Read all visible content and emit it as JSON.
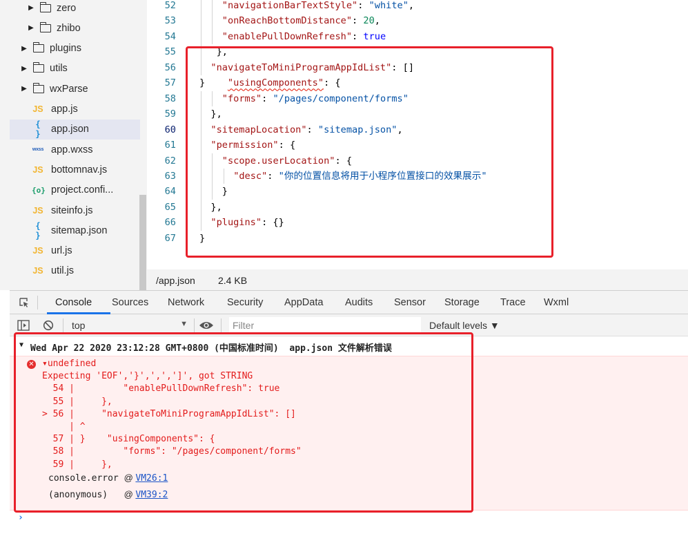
{
  "file_tree": {
    "items": [
      {
        "type": "folder",
        "label": "zero",
        "indent": 2
      },
      {
        "type": "folder",
        "label": "zhibo",
        "indent": 2
      },
      {
        "type": "folder",
        "label": "plugins",
        "indent": 1
      },
      {
        "type": "folder",
        "label": "utils",
        "indent": 1
      },
      {
        "type": "folder",
        "label": "wxParse",
        "indent": 1
      },
      {
        "type": "js",
        "label": "app.js",
        "icon": "JS"
      },
      {
        "type": "json",
        "label": "app.json",
        "icon": "{ }",
        "selected": true
      },
      {
        "type": "wxss",
        "label": "app.wxss",
        "icon": "wxss"
      },
      {
        "type": "js",
        "label": "bottomnav.js",
        "icon": "JS"
      },
      {
        "type": "config",
        "label": "project.confi...",
        "icon": "{o}"
      },
      {
        "type": "js",
        "label": "siteinfo.js",
        "icon": "JS"
      },
      {
        "type": "json",
        "label": "sitemap.json",
        "icon": "{ }"
      },
      {
        "type": "js",
        "label": "url.js",
        "icon": "JS"
      },
      {
        "type": "js",
        "label": "util.js",
        "icon": "JS"
      }
    ]
  },
  "editor": {
    "lines": [
      {
        "num": "52",
        "indent": 4,
        "tokens": [
          [
            "k",
            "\"navigationBarTextStyle\""
          ],
          [
            "p",
            ": "
          ],
          [
            "s",
            "\"white\""
          ],
          [
            "p",
            ","
          ]
        ]
      },
      {
        "num": "53",
        "indent": 4,
        "tokens": [
          [
            "k",
            "\"onReachBottomDistance\""
          ],
          [
            "p",
            ": "
          ],
          [
            "n",
            "20"
          ],
          [
            "p",
            ","
          ]
        ]
      },
      {
        "num": "54",
        "indent": 4,
        "tokens": [
          [
            "k",
            "\"enablePullDownRefresh\""
          ],
          [
            "p",
            ": "
          ],
          [
            "b",
            "true"
          ]
        ]
      },
      {
        "num": "55",
        "indent": 3,
        "tokens": [
          [
            "p",
            "},"
          ]
        ]
      },
      {
        "num": "56",
        "indent": 2,
        "tokens": [
          [
            "k",
            "\"navigateToMiniProgramAppIdList\""
          ],
          [
            "p",
            ": []"
          ]
        ]
      },
      {
        "num": "57",
        "indent": 0,
        "tokens": [
          [
            "p",
            "}    "
          ],
          [
            "ksq",
            "\"usingComponents\""
          ],
          [
            "p",
            ": {"
          ]
        ]
      },
      {
        "num": "58",
        "indent": 4,
        "tokens": [
          [
            "k",
            "\"forms\""
          ],
          [
            "p",
            ": "
          ],
          [
            "s",
            "\"/pages/component/forms\""
          ]
        ]
      },
      {
        "num": "59",
        "indent": 2,
        "tokens": [
          [
            "p",
            "},"
          ]
        ]
      },
      {
        "num": "60",
        "indent": 2,
        "active": true,
        "tokens": [
          [
            "k",
            "\"sitemapLocation\""
          ],
          [
            "p",
            ": "
          ],
          [
            "s",
            "\"sitemap.json\""
          ],
          [
            "p",
            ","
          ]
        ]
      },
      {
        "num": "61",
        "indent": 2,
        "tokens": [
          [
            "k",
            "\"permission\""
          ],
          [
            "p",
            ": {"
          ]
        ]
      },
      {
        "num": "62",
        "indent": 4,
        "tokens": [
          [
            "k",
            "\"scope.userLocation\""
          ],
          [
            "p",
            ": {"
          ]
        ]
      },
      {
        "num": "63",
        "indent": 6,
        "tokens": [
          [
            "k",
            "\"desc\""
          ],
          [
            "p",
            ": "
          ],
          [
            "s",
            "\"你的位置信息将用于小程序位置接口的效果展示\""
          ]
        ]
      },
      {
        "num": "64",
        "indent": 4,
        "tokens": [
          [
            "p",
            "}"
          ]
        ]
      },
      {
        "num": "65",
        "indent": 2,
        "tokens": [
          [
            "p",
            "},"
          ]
        ]
      },
      {
        "num": "66",
        "indent": 2,
        "tokens": [
          [
            "k",
            "\"plugins\""
          ],
          [
            "p",
            ": {}"
          ]
        ]
      },
      {
        "num": "67",
        "indent": 0,
        "tokens": [
          [
            "p",
            "}"
          ]
        ]
      }
    ]
  },
  "status": {
    "path": "/app.json",
    "size": "2.4 KB"
  },
  "devtools": {
    "tabs": [
      "Console",
      "Sources",
      "Network",
      "Security",
      "AppData",
      "Audits",
      "Sensor",
      "Storage",
      "Trace",
      "Wxml"
    ],
    "active_tab": "Console"
  },
  "console_toolbar": {
    "context": "top",
    "filter_placeholder": "Filter",
    "levels": "Default levels ▼"
  },
  "console": {
    "header": "Wed Apr 22 2020 23:12:28 GMT+0800 (中国标准时间)  app.json 文件解析错误",
    "error_lines": [
      "▾undefined",
      "Expecting 'EOF','}',',',']', got STRING",
      "  54 |         \"enablePullDownRefresh\": true",
      "  55 |     },",
      "> 56 |     \"navigateToMiniProgramAppIdList\": []",
      "     | ^",
      "  57 | }    \"usingComponents\": {",
      "  58 |         \"forms\": \"/pages/component/forms\"",
      "  59 |     },"
    ],
    "stack": [
      {
        "fn": "console.error",
        "at": "@",
        "link": "VM26:1"
      },
      {
        "fn": "(anonymous)  ",
        "at": "@",
        "link": "VM39:2"
      }
    ],
    "prompt": "›"
  }
}
